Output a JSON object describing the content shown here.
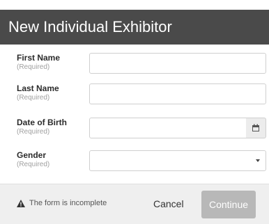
{
  "dialog": {
    "title": "New Individual Exhibitor"
  },
  "fields": [
    {
      "label": "First Name",
      "required": "(Required)",
      "value": ""
    },
    {
      "label": "Last Name",
      "required": "(Required)",
      "value": ""
    },
    {
      "label": "Date of Birth",
      "required": "(Required)",
      "value": ""
    },
    {
      "label": "Gender",
      "required": "(Required)",
      "value": ""
    }
  ],
  "footer": {
    "warning": "The form is incomplete",
    "cancel_label": "Cancel",
    "continue_label": "Continue"
  },
  "icons": {
    "calendar": "calendar-icon",
    "warning": "warning-icon",
    "dropdown": "chevron-down-icon"
  }
}
